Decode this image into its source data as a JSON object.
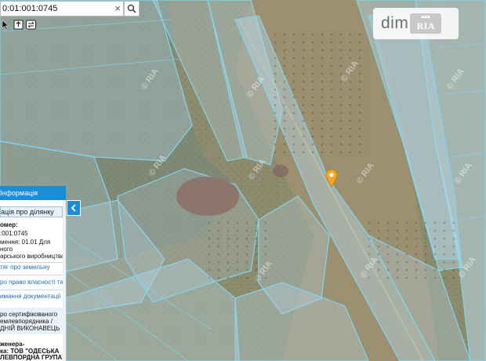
{
  "search": {
    "value": "0:01:001:0745",
    "clear_symbol": "×"
  },
  "toolbar": {
    "tools": [
      "arrow-pointer-icon",
      "export-icon",
      "swap-layers-icon"
    ]
  },
  "map": {
    "watermark_text": "© RIA",
    "marker_icon": "location-pin-icon",
    "marker_color": "#f5a623",
    "parcel_fill": "#b9d8e8",
    "parcel_stroke": "#7fd6ee"
  },
  "logo": {
    "text": "dim",
    "badge": "RIA"
  },
  "panel": {
    "header": "Інформація",
    "tab": "ація про ділянку",
    "lines": [
      "омер:",
      ":001:0745",
      "мення: 01.01 Для",
      "ного",
      "арського виробництва"
    ],
    "links": [
      "тяг про земельну",
      "ро право власності та",
      "имання документації із"
    ],
    "cert_lines": [
      "ро сертифікованого",
      "емлевпорядника /",
      "ДНІЙ ВИКОНАВЕЦЬ"
    ],
    "engineer_label": "женера-",
    "engineer_line": "ка: ТОВ \"ОДЕСЬКА",
    "engineer_line2": "ЛЕВПОРДНА ГРУПА\"",
    "collapse_symbol": "‹"
  },
  "colors": {
    "panel_blue": "#1b8dd6",
    "parcel_line": "#7fd6ee"
  }
}
